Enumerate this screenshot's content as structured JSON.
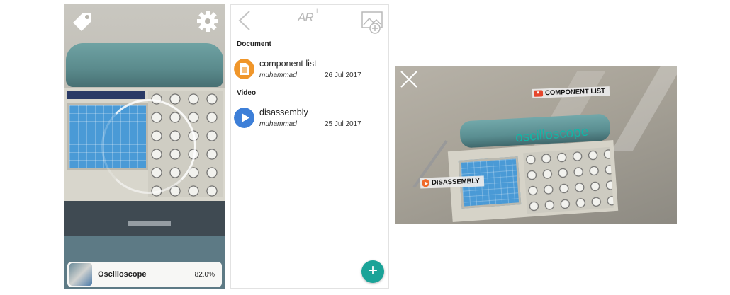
{
  "camera_panel": {
    "card_title": "Oscilloscope",
    "card_value": "82.0%",
    "icons": [
      "tag-icon",
      "gear-icon"
    ]
  },
  "list_panel": {
    "header_icons": [
      "back-icon",
      "ar-plus-icon",
      "add-image-icon"
    ],
    "ar_label": "AR",
    "ar_plus": "+",
    "sections": [
      {
        "title": "Document",
        "items": [
          {
            "title": "component list",
            "author": "muhammad",
            "date": "26 Jul 2017",
            "icon": "document-icon",
            "color": "#f0962a"
          }
        ]
      },
      {
        "title": "Video",
        "items": [
          {
            "title": "disassembly",
            "author": "muhammad",
            "date": "25 Jul 2017",
            "icon": "play-icon",
            "color": "#3d7fd8"
          }
        ]
      }
    ],
    "fab_label": "+",
    "accent": "#1aa398"
  },
  "ar_panel": {
    "object_label": "oscilloscope",
    "tags": [
      {
        "label": "COMPONENT LIST",
        "icon": "document-tag-icon"
      },
      {
        "label": "DISASSEMBLY",
        "icon": "video-tag-icon"
      }
    ],
    "label_color": "#13b5a6"
  }
}
